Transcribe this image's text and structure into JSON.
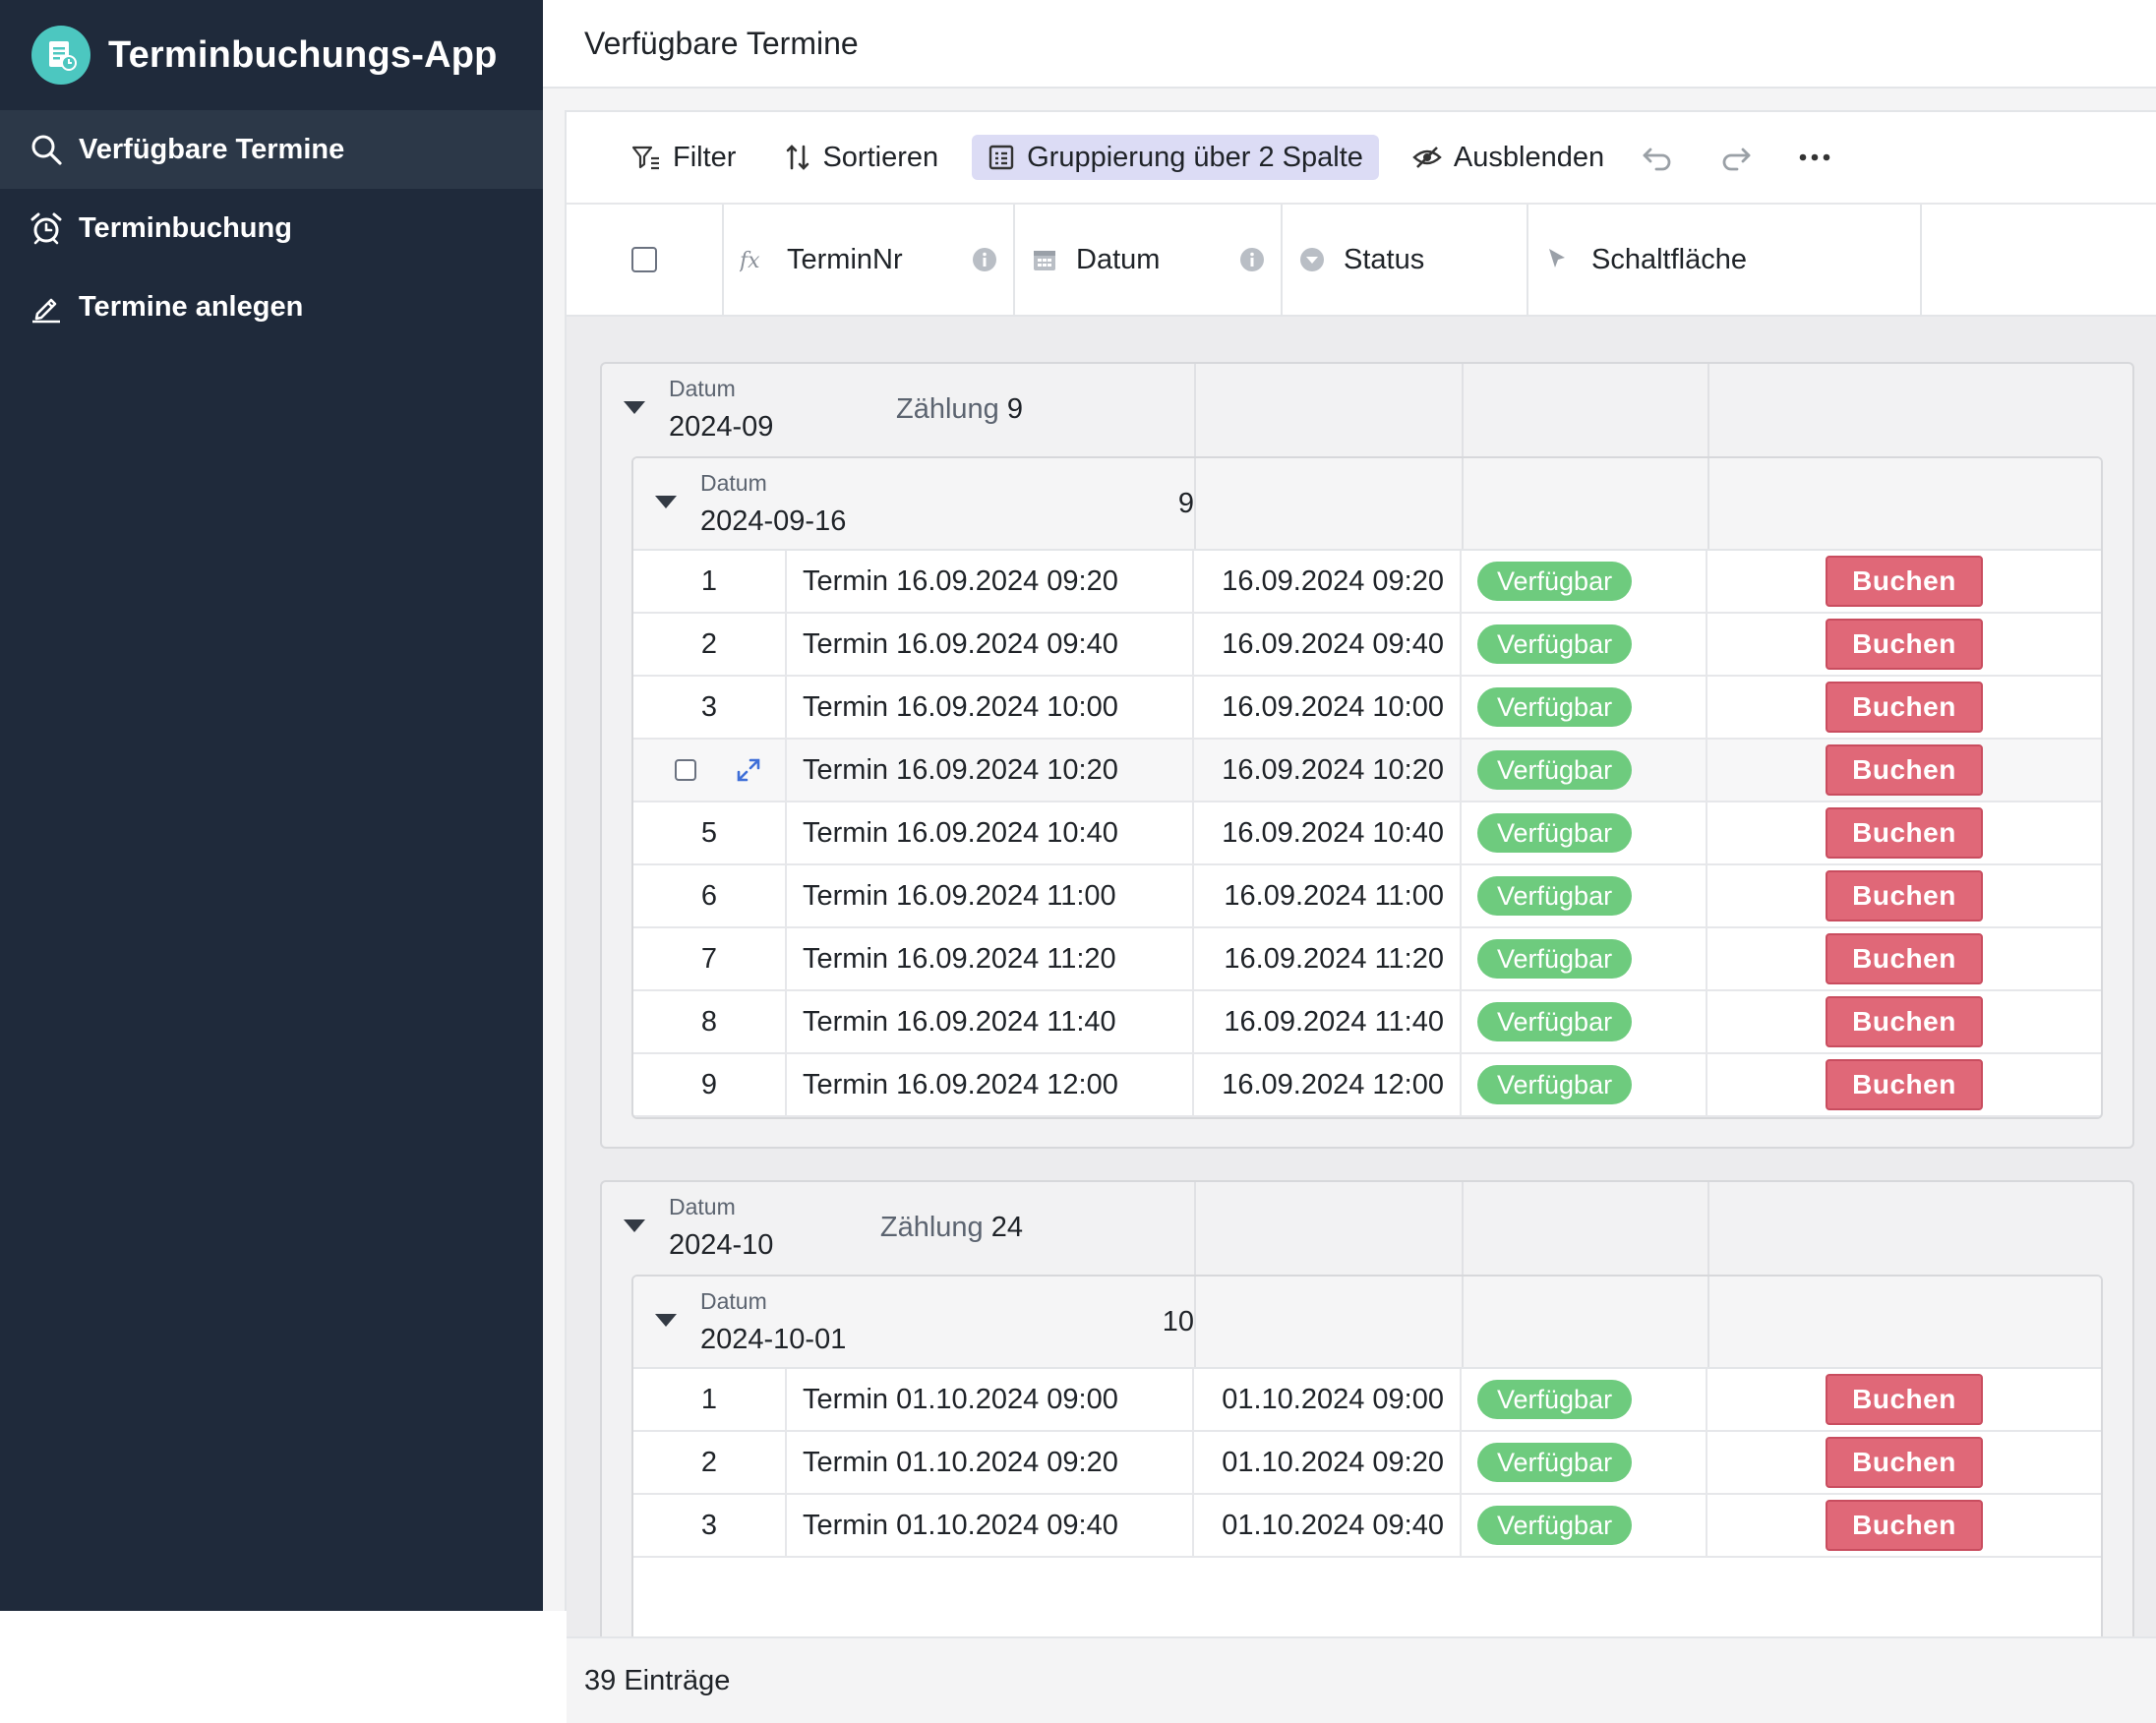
{
  "app": {
    "title": "Terminbuchungs-App"
  },
  "sidebar": {
    "items": [
      {
        "label": "Verfügbare Termine",
        "icon": "search-icon",
        "active": true
      },
      {
        "label": "Terminbuchung",
        "icon": "alarm-clock-icon",
        "active": false
      },
      {
        "label": "Termine anlegen",
        "icon": "pencil-icon",
        "active": false
      }
    ]
  },
  "page": {
    "title": "Verfügbare Termine"
  },
  "toolbar": {
    "filter": "Filter",
    "sort": "Sortieren",
    "group": "Gruppierung über 2 Spalte",
    "hide": "Ausblenden"
  },
  "columns": {
    "terminnr": "TerminNr",
    "datum": "Datum",
    "status": "Status",
    "button": "Schaltfläche"
  },
  "groups": [
    {
      "label": "Datum",
      "value": "2024-09",
      "count_label": "Zählung",
      "count": "9",
      "subgroup": {
        "label": "Datum",
        "value": "2024-09-16",
        "count": "9",
        "rows": [
          {
            "num": "1",
            "name": "Termin 16.09.2024 09:20",
            "date": "16.09.2024 09:20",
            "status": "Verfügbar",
            "button": "Buchen"
          },
          {
            "num": "2",
            "name": "Termin 16.09.2024 09:40",
            "date": "16.09.2024 09:40",
            "status": "Verfügbar",
            "button": "Buchen"
          },
          {
            "num": "3",
            "name": "Termin 16.09.2024 10:00",
            "date": "16.09.2024 10:00",
            "status": "Verfügbar",
            "button": "Buchen"
          },
          {
            "num": "",
            "hover": true,
            "name": "Termin 16.09.2024 10:20",
            "date": "16.09.2024 10:20",
            "status": "Verfügbar",
            "button": "Buchen"
          },
          {
            "num": "5",
            "name": "Termin 16.09.2024 10:40",
            "date": "16.09.2024 10:40",
            "status": "Verfügbar",
            "button": "Buchen"
          },
          {
            "num": "6",
            "name": "Termin 16.09.2024 11:00",
            "date": "16.09.2024 11:00",
            "status": "Verfügbar",
            "button": "Buchen"
          },
          {
            "num": "7",
            "name": "Termin 16.09.2024 11:20",
            "date": "16.09.2024 11:20",
            "status": "Verfügbar",
            "button": "Buchen"
          },
          {
            "num": "8",
            "name": "Termin 16.09.2024 11:40",
            "date": "16.09.2024 11:40",
            "status": "Verfügbar",
            "button": "Buchen"
          },
          {
            "num": "9",
            "name": "Termin 16.09.2024 12:00",
            "date": "16.09.2024 12:00",
            "status": "Verfügbar",
            "button": "Buchen"
          }
        ]
      }
    },
    {
      "label": "Datum",
      "value": "2024-10",
      "count_label": "Zählung",
      "count": "24",
      "subgroup": {
        "label": "Datum",
        "value": "2024-10-01",
        "count": "10",
        "rows": [
          {
            "num": "1",
            "name": "Termin 01.10.2024 09:00",
            "date": "01.10.2024 09:00",
            "status": "Verfügbar",
            "button": "Buchen"
          },
          {
            "num": "2",
            "name": "Termin 01.10.2024 09:20",
            "date": "01.10.2024 09:20",
            "status": "Verfügbar",
            "button": "Buchen"
          },
          {
            "num": "3",
            "name": "Termin 01.10.2024 09:40",
            "date": "01.10.2024 09:40",
            "status": "Verfügbar",
            "button": "Buchen"
          }
        ]
      }
    }
  ],
  "footer": {
    "count": "39 Einträge"
  },
  "colors": {
    "sidebar": "#1f2a3b",
    "accent": "#4cc7c0",
    "status_available": "#6ecb7e",
    "book_button": "#e06878",
    "group_active": "#dcdcf5"
  }
}
